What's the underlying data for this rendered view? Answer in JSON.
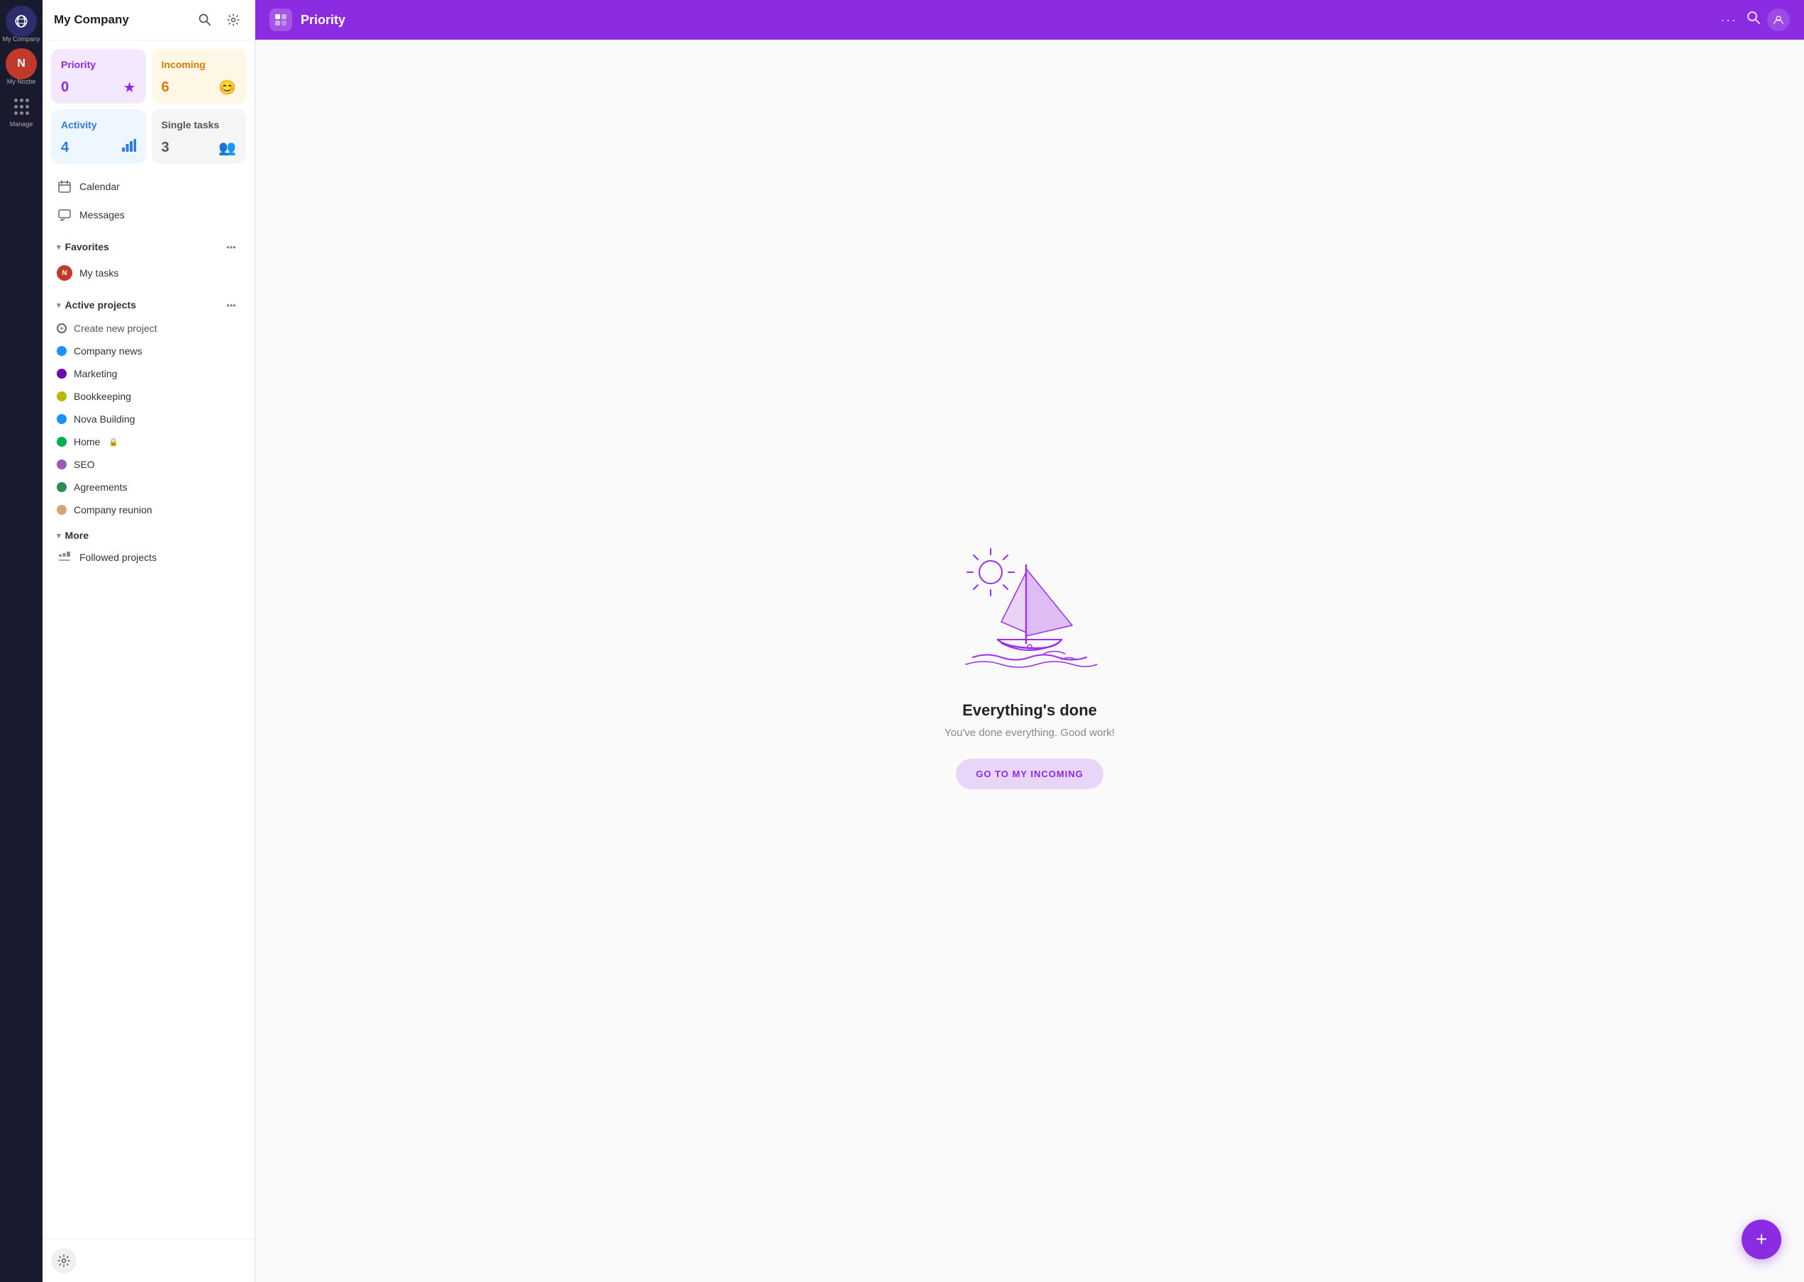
{
  "iconBar": {
    "companyInitial": "🌐",
    "companyLabel": "My Company",
    "userLabel": "My Nozbe",
    "manageLabel": "Manage"
  },
  "sidebar": {
    "title": "My Company",
    "searchIcon": "🔍",
    "settingsIcon": "⚙",
    "cards": [
      {
        "id": "priority",
        "label": "Priority",
        "count": "0",
        "icon": "★",
        "colorClass": "card-priority"
      },
      {
        "id": "incoming",
        "label": "Incoming",
        "count": "6",
        "icon": "😊",
        "colorClass": "card-incoming"
      },
      {
        "id": "activity",
        "label": "Activity",
        "count": "4",
        "icon": "📶",
        "colorClass": "card-activity"
      },
      {
        "id": "single-tasks",
        "label": "Single tasks",
        "count": "3",
        "icon": "👥",
        "colorClass": "card-single"
      }
    ],
    "navItems": [
      {
        "id": "calendar",
        "label": "Calendar",
        "icon": "📅"
      },
      {
        "id": "messages",
        "label": "Messages",
        "icon": "💬"
      }
    ],
    "favorites": {
      "label": "Favorites",
      "items": [
        {
          "id": "my-tasks",
          "label": "My tasks",
          "hasAvatar": true
        }
      ]
    },
    "activeProjects": {
      "label": "Active projects",
      "createNew": "Create new project",
      "items": [
        {
          "id": "company-news",
          "label": "Company news",
          "color": "#1e90ff"
        },
        {
          "id": "marketing",
          "label": "Marketing",
          "color": "#6a0dad"
        },
        {
          "id": "bookkeeping",
          "label": "Bookkeeping",
          "color": "#b8b800"
        },
        {
          "id": "nova-building",
          "label": "Nova Building",
          "color": "#1e90ff"
        },
        {
          "id": "home",
          "label": "Home",
          "color": "#00b050",
          "locked": true
        },
        {
          "id": "seo",
          "label": "SEO",
          "color": "#9b59b6"
        },
        {
          "id": "agreements",
          "label": "Agreements",
          "color": "#2e8b57"
        },
        {
          "id": "company-reunion",
          "label": "Company reunion",
          "color": "#d2a679"
        }
      ]
    },
    "more": {
      "label": "More",
      "followedLabel": "Followed projects"
    },
    "bottomIcon": "⚙"
  },
  "topBar": {
    "iconLabel": "P",
    "title": "Priority",
    "moreIcon": "•••",
    "searchIcon": "🔍",
    "filterIcon": "👤"
  },
  "mainContent": {
    "emptyTitle": "Everything's done",
    "emptySubtitle": "You've done everything. Good work!",
    "gotoButton": "GO TO MY INCOMING"
  },
  "fab": {
    "label": "+"
  }
}
